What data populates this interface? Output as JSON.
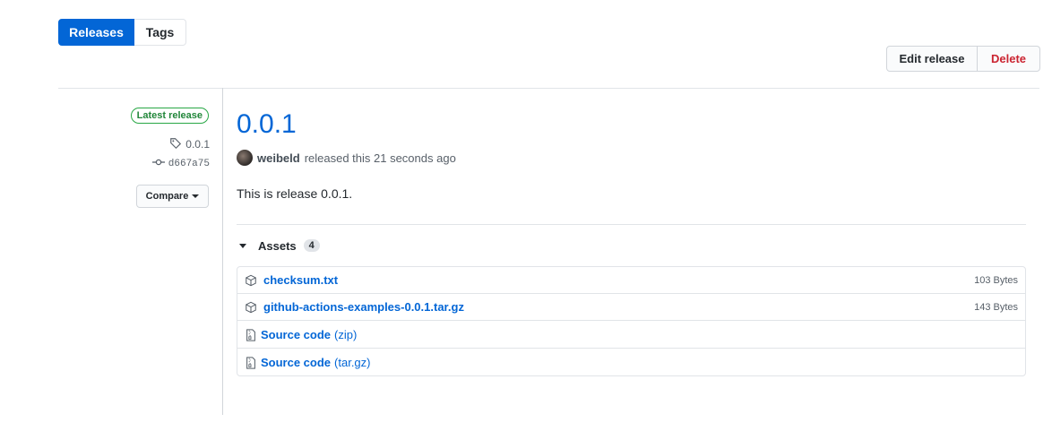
{
  "tabs": [
    {
      "label": "Releases",
      "active": true
    },
    {
      "label": "Tags",
      "active": false
    }
  ],
  "actions": {
    "edit_label": "Edit release",
    "delete_label": "Delete"
  },
  "sidebar": {
    "badge": "Latest release",
    "tag": "0.0.1",
    "commit": "d667a75",
    "compare_label": "Compare"
  },
  "release": {
    "title": "0.0.1",
    "author": "weibeld",
    "released_text": "released this 21 seconds ago",
    "body": "This is release 0.0.1."
  },
  "assets": {
    "label": "Assets",
    "count": "4",
    "items": [
      {
        "name": "checksum.txt",
        "suffix": "",
        "size": "103 Bytes",
        "icon": "package-icon"
      },
      {
        "name": "github-actions-examples-0.0.1.tar.gz",
        "suffix": "",
        "size": "143 Bytes",
        "icon": "package-icon"
      },
      {
        "name": "Source code",
        "suffix": "(zip)",
        "size": "",
        "icon": "file-zip-icon"
      },
      {
        "name": "Source code",
        "suffix": "(tar.gz)",
        "size": "",
        "icon": "file-zip-icon"
      }
    ]
  },
  "colors": {
    "accent": "#0366d6",
    "danger": "#cb2431",
    "success": "#28a745"
  }
}
